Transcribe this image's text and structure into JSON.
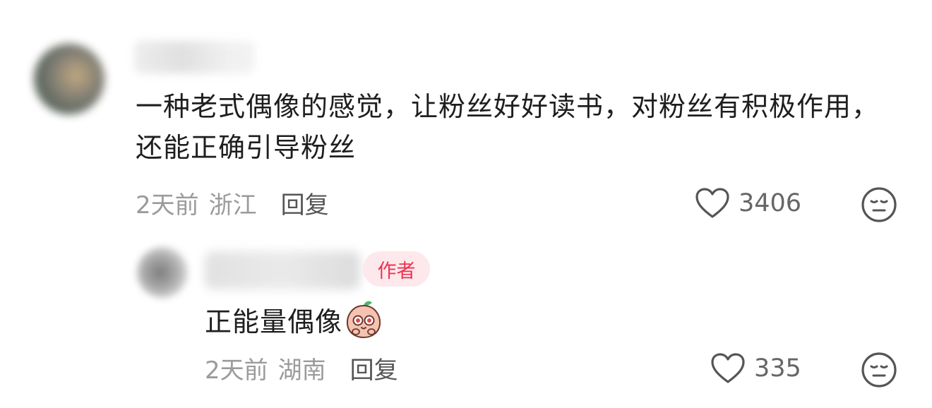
{
  "comment": {
    "author_name": "",
    "text": "一种老式偶像的感觉，让粉丝好好读书，对粉丝有积极作用，还能正确引导粉丝",
    "time": "2天前",
    "location": "浙江",
    "reply_label": "回复",
    "like_count": "3406",
    "like_icon": "heart-outline-icon",
    "reaction_icon": "neutral-face-icon"
  },
  "reply": {
    "author_name": "",
    "badge": "作者",
    "text": "正能量偶像",
    "sticker": "peach-character-sticker",
    "time": "2天前",
    "location": "湖南",
    "reply_label": "回复",
    "like_count": "335",
    "like_icon": "heart-outline-icon",
    "reaction_icon": "neutral-face-icon"
  },
  "colors": {
    "badge_bg": "#fde8ec",
    "badge_text": "#ee3350",
    "meta_text": "#9b9b9b",
    "reply_text": "#555555"
  }
}
